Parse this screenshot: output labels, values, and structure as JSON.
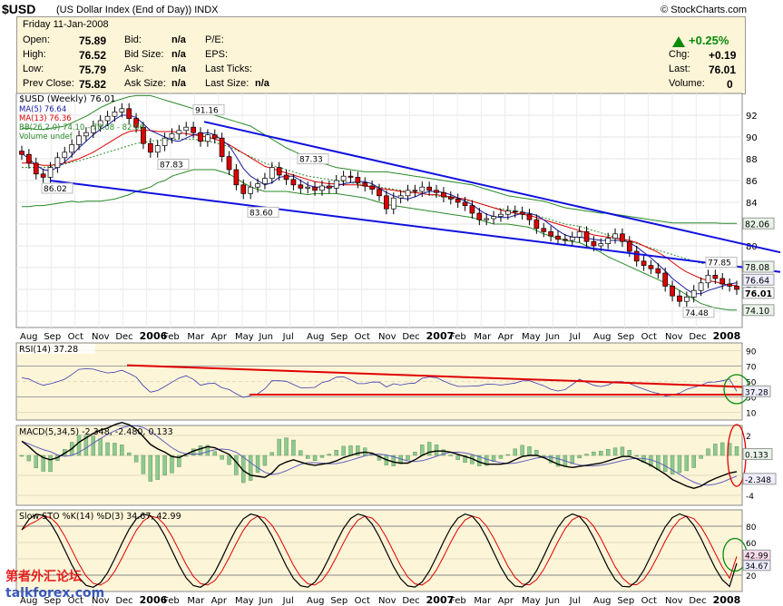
{
  "header": {
    "symbol": "$USD",
    "subtitle": "(US Dollar Index (End of Day))",
    "exchange": "INDX",
    "brand": "© StockCharts.com"
  },
  "quote": {
    "date": "Friday 11-Jan-2008",
    "open_label": "Open:",
    "open": "75.89",
    "high_label": "High:",
    "high": "76.52",
    "low_label": "Low:",
    "low": "75.79",
    "prev_close_label": "Prev Close:",
    "prev_close": "75.82",
    "bid_label": "Bid:",
    "bid": "n/a",
    "bid_size_label": "Bid Size:",
    "bid_size": "n/a",
    "ask_label": "Ask:",
    "ask": "n/a",
    "ask_size_label": "Ask Size:",
    "ask_size": "n/a",
    "pe_label": "P/E:",
    "eps_label": "EPS:",
    "last_ticks_label": "Last Ticks:",
    "last_size_label": "Last Size:",
    "last_size": "n/a",
    "change_pct": "+0.25%",
    "chg_label": "Chg:",
    "chg": "+0.19",
    "last_label": "Last:",
    "last": "76.01",
    "volume_label": "Volume:",
    "volume": "0"
  },
  "chart_data": [
    {
      "type": "candlestick",
      "title": "$USD (Weekly) 76.01",
      "legend": [
        "MA(5) 76.64",
        "MA(13) 76.36",
        "BB(26,2.0) 74.10 - 78.08 - 82.06",
        "Volume undef"
      ],
      "ylim": [
        72.5,
        94
      ],
      "yticks": [
        74,
        76,
        78,
        80,
        82,
        84,
        86,
        88,
        90,
        92
      ],
      "x_labels": [
        "Aug",
        "Sep",
        "Oct",
        "Nov",
        "Dec",
        "2006",
        "Feb",
        "Mar",
        "Apr",
        "May",
        "Jun",
        "Jul",
        "Aug",
        "Sep",
        "Oct",
        "Nov",
        "Dec",
        "2007",
        "Feb",
        "Mar",
        "Apr",
        "May",
        "Jun",
        "Jul",
        "Aug",
        "Sep",
        "Oct",
        "Nov",
        "Dec",
        "2008"
      ],
      "annotations": [
        "91.16",
        "87.83",
        "86.02",
        "87.33",
        "83.60",
        "77.85",
        "74.48"
      ],
      "right_labels": [
        "82.06",
        "78.08",
        "76.64",
        "76.01",
        "74.10"
      ],
      "close": [
        88.4,
        87.6,
        86.6,
        86.3,
        87.2,
        88.1,
        88.6,
        89.3,
        90.1,
        90.4,
        91.0,
        91.5,
        91.9,
        92.3,
        92.6,
        91.7,
        90.9,
        89.4,
        88.6,
        89.2,
        89.9,
        90.3,
        90.6,
        90.9,
        90.4,
        89.6,
        90.2,
        89.9,
        88.2,
        87.0,
        85.6,
        84.8,
        85.4,
        85.7,
        86.2,
        87.2,
        86.5,
        86.1,
        85.6,
        85.3,
        85.4,
        85.1,
        85.5,
        85.3,
        86.0,
        86.4,
        86.3,
        85.8,
        85.5,
        85.2,
        84.6,
        83.4,
        84.4,
        84.6,
        85.1,
        85.0,
        85.4,
        85.1,
        84.9,
        84.5,
        84.3,
        84.0,
        83.7,
        83.0,
        82.4,
        82.5,
        82.7,
        82.9,
        83.2,
        83.1,
        82.9,
        82.4,
        81.6,
        81.3,
        80.9,
        80.6,
        80.5,
        80.8,
        81.3,
        80.4,
        80.0,
        80.2,
        80.7,
        81.1,
        80.4,
        79.5,
        78.6,
        78.2,
        77.9,
        77.5,
        76.3,
        75.4,
        74.9,
        75.3,
        75.9,
        76.6,
        77.3,
        77.0,
        76.5,
        76.3,
        76.0
      ],
      "ma5": [
        88.5,
        88.0,
        87.4,
        87.0,
        86.9,
        87.2,
        87.7,
        88.3,
        89.0,
        89.6,
        90.2,
        90.7,
        91.1,
        91.6,
        92.0,
        92.0,
        91.8,
        91.2,
        90.6,
        90.3,
        90.0,
        89.7,
        89.6,
        89.9,
        90.2,
        90.3,
        90.4,
        90.2,
        89.7,
        89.2,
        88.2,
        87.1,
        86.4,
        86.0,
        85.6,
        85.8,
        86.3,
        86.4,
        86.4,
        86.0,
        85.6,
        85.4,
        85.4,
        85.4,
        85.5,
        85.7,
        85.8,
        85.9,
        85.9,
        85.7,
        85.3,
        84.9,
        84.6,
        84.4,
        84.3,
        84.5,
        84.8,
        85.0,
        85.0,
        84.9,
        84.7,
        84.4,
        84.1,
        83.8,
        83.3,
        82.9,
        82.7,
        82.6,
        82.6,
        82.8,
        83.0,
        83.0,
        82.8,
        82.4,
        81.9,
        81.4,
        81.0,
        80.8,
        80.8,
        80.7,
        80.6,
        80.5,
        80.5,
        80.5,
        80.5,
        80.3,
        79.9,
        79.4,
        78.9,
        78.3,
        77.7,
        77.0,
        76.5,
        76.0,
        75.6,
        75.6,
        75.9,
        76.1,
        76.3,
        76.5,
        76.6
      ],
      "ma13": [
        87.6,
        87.6,
        87.5,
        87.4,
        87.4,
        87.5,
        87.6,
        87.8,
        88.0,
        88.3,
        88.6,
        89.0,
        89.4,
        89.8,
        90.2,
        90.5,
        90.6,
        90.6,
        90.6,
        90.5,
        90.5,
        90.5,
        90.4,
        90.3,
        90.2,
        90.1,
        90.0,
        89.8,
        89.6,
        89.3,
        88.9,
        88.5,
        88.1,
        87.7,
        87.3,
        87.1,
        86.9,
        86.7,
        86.5,
        86.3,
        86.1,
        85.9,
        85.8,
        85.7,
        85.7,
        85.6,
        85.6,
        85.6,
        85.5,
        85.4,
        85.3,
        85.2,
        85.1,
        85.0,
        84.9,
        84.9,
        84.8,
        84.7,
        84.7,
        84.6,
        84.5,
        84.4,
        84.3,
        84.1,
        83.9,
        83.7,
        83.5,
        83.3,
        83.1,
        83.0,
        82.9,
        82.8,
        82.6,
        82.4,
        82.2,
        82.0,
        81.8,
        81.6,
        81.4,
        81.2,
        81.0,
        80.9,
        80.8,
        80.7,
        80.6,
        80.5,
        80.3,
        80.0,
        79.7,
        79.4,
        79.0,
        78.5,
        78.0,
        77.6,
        77.3,
        77.0,
        76.8,
        76.7,
        76.5,
        76.4,
        76.36
      ],
      "bb_mid": [
        87.2,
        87.2,
        87.2,
        87.2,
        87.3,
        87.4,
        87.5,
        87.7,
        87.8,
        88.0,
        88.2,
        88.4,
        88.6,
        88.8,
        89.0,
        89.2,
        89.4,
        89.5,
        89.6,
        89.7,
        89.7,
        89.8,
        89.8,
        89.8,
        89.8,
        89.7,
        89.6,
        89.5,
        89.3,
        89.1,
        88.8,
        88.5,
        88.2,
        87.9,
        87.6,
        87.4,
        87.2,
        87.0,
        86.8,
        86.6,
        86.4,
        86.3,
        86.2,
        86.1,
        86.0,
        85.9,
        85.8,
        85.7,
        85.6,
        85.5,
        85.4,
        85.3,
        85.2,
        85.1,
        85.0,
        84.9,
        84.8,
        84.7,
        84.6,
        84.5,
        84.4,
        84.3,
        84.2,
        84.1,
        83.9,
        83.7,
        83.5,
        83.4,
        83.3,
        83.2,
        83.1,
        83.0,
        82.8,
        82.6,
        82.4,
        82.2,
        82.0,
        81.9,
        81.8,
        81.6,
        81.4,
        81.2,
        81.0,
        80.8,
        80.6,
        80.4,
        80.2,
        80.0,
        79.8,
        79.6,
        79.4,
        79.2,
        79.0,
        78.8,
        78.6,
        78.4,
        78.3,
        78.2,
        78.15,
        78.1,
        78.08
      ],
      "bb_up": [
        90.8,
        90.8,
        90.7,
        90.7,
        90.8,
        90.9,
        91.0,
        91.3,
        91.6,
        91.9,
        92.3,
        92.7,
        93.0,
        93.3,
        93.5,
        93.7,
        93.8,
        93.8,
        93.8,
        93.6,
        93.4,
        93.2,
        93.0,
        92.8,
        92.6,
        92.4,
        92.2,
        92.0,
        91.8,
        91.6,
        91.4,
        91.2,
        91.0,
        90.6,
        90.2,
        89.8,
        89.4,
        89.0,
        88.7,
        88.4,
        88.1,
        87.8,
        87.6,
        87.4,
        87.2,
        87.1,
        87.0,
        86.9,
        86.8,
        86.8,
        86.8,
        86.8,
        86.7,
        86.6,
        86.5,
        86.4,
        86.3,
        86.2,
        86.1,
        86.0,
        85.9,
        85.8,
        85.7,
        85.6,
        85.4,
        85.2,
        85.0,
        84.8,
        84.6,
        84.5,
        84.4,
        84.3,
        84.2,
        84.1,
        83.9,
        83.7,
        83.5,
        83.4,
        83.3,
        83.2,
        83.1,
        83.0,
        83.0,
        82.9,
        82.8,
        82.7,
        82.6,
        82.5,
        82.4,
        82.3,
        82.2,
        82.1,
        82.1,
        82.1,
        82.1,
        82.1,
        82.1,
        82.1,
        82.06,
        82.06,
        82.06
      ],
      "bb_low": [
        83.6,
        83.6,
        83.7,
        83.7,
        83.8,
        83.9,
        84.0,
        84.1,
        84.0,
        84.1,
        84.1,
        84.1,
        84.2,
        84.3,
        84.5,
        84.7,
        85.0,
        85.2,
        85.4,
        85.8,
        86.0,
        86.4,
        86.6,
        86.8,
        87.0,
        87.0,
        87.0,
        87.0,
        86.8,
        86.6,
        86.2,
        85.8,
        85.4,
        85.2,
        85.0,
        85.0,
        85.0,
        85.0,
        84.9,
        84.8,
        84.7,
        84.8,
        84.8,
        84.8,
        84.8,
        84.7,
        84.6,
        84.5,
        84.4,
        84.2,
        84.0,
        83.8,
        83.7,
        83.6,
        83.5,
        83.4,
        83.3,
        83.2,
        83.1,
        83.0,
        82.9,
        82.8,
        82.7,
        82.6,
        82.4,
        82.2,
        82.0,
        82.0,
        82.0,
        81.9,
        81.8,
        81.7,
        81.4,
        81.1,
        80.9,
        80.7,
        80.5,
        80.4,
        80.3,
        80.0,
        79.7,
        79.4,
        79.0,
        78.7,
        78.4,
        78.1,
        77.8,
        77.5,
        77.2,
        76.9,
        76.6,
        76.3,
        75.9,
        75.5,
        75.1,
        74.7,
        74.5,
        74.3,
        74.2,
        74.1,
        74.1
      ]
    },
    {
      "type": "line",
      "title": "RSI(14) 37.28",
      "ylim": [
        0,
        100
      ],
      "yticks": [
        10,
        30,
        50,
        70,
        90
      ],
      "last": "37.28"
    },
    {
      "type": "line",
      "title": "MACD(5,34,5) -2.348, -2.480, 0.133",
      "ylim": [
        -5,
        3
      ],
      "yticks": [
        2,
        0,
        -2,
        -4
      ],
      "right_labels": [
        "0.133",
        "-2.348"
      ]
    },
    {
      "type": "line",
      "title": "Slow STO %K(14) %D(3) 34.67, 42.99",
      "ylim": [
        0,
        100
      ],
      "yticks": [
        20,
        40,
        60,
        80
      ],
      "right_labels": [
        "42.99",
        "34.67"
      ]
    }
  ],
  "watermark": {
    "line1": "第者外汇论坛",
    "line2": "talkforex.com"
  }
}
